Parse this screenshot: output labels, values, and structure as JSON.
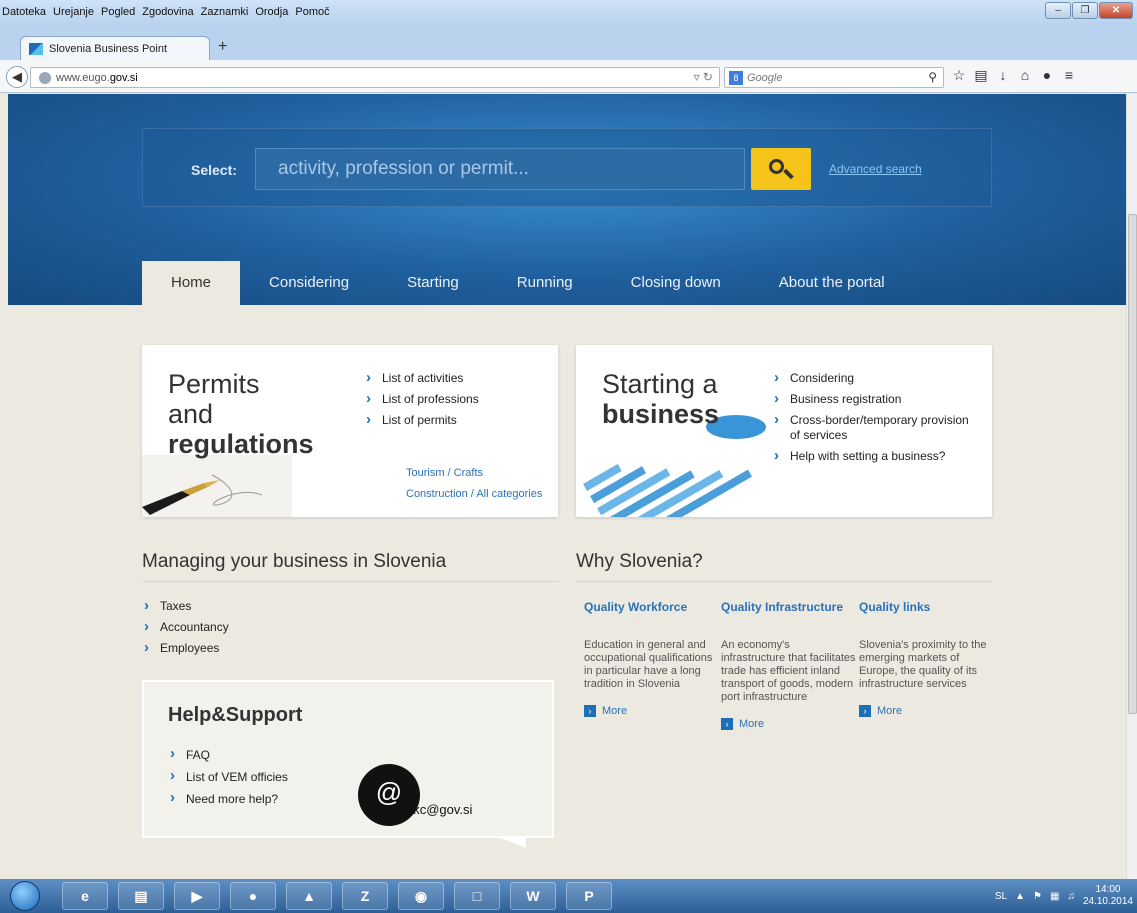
{
  "browser": {
    "menu": [
      "Datoteka",
      "Urejanje",
      "Pogled",
      "Zgodovina",
      "Zaznamki",
      "Orodja",
      "Pomoč"
    ],
    "tab_title": "Slovenia Business Point",
    "url_prefix": "www.eugo.",
    "url_domain": "gov.si",
    "search_placeholder": "Google"
  },
  "hero": {
    "select_label": "Select:",
    "search_placeholder": "activity, profession or permit...",
    "advanced_search": "Advanced search"
  },
  "nav": {
    "items": [
      "Home",
      "Considering",
      "Starting",
      "Running",
      "Closing down",
      "About the portal"
    ],
    "active": "Home"
  },
  "permits": {
    "title_line1": "Permits",
    "title_line2": "and",
    "title_line3": "regulations",
    "links": [
      "List of activities",
      "List of professions",
      "List of permits"
    ],
    "sublinks": [
      "Tourism / Crafts",
      "Construction / All categories"
    ]
  },
  "starting": {
    "title_line1": "Starting a",
    "title_line2": "business",
    "links": [
      "Considering",
      "Business registration",
      "Cross-border/temporary provision of services",
      "Help with setting a business?"
    ]
  },
  "managing": {
    "title": "Managing your business in Slovenia",
    "links": [
      "Taxes",
      "Accountancy",
      "Employees"
    ]
  },
  "why": {
    "title": "Why Slovenia?",
    "columns": [
      {
        "title": "Quality Workforce",
        "text": "Education in general and occupational qualifications in particular have a long tradition in Slovenia",
        "more": "More"
      },
      {
        "title": "Quality Infrastructure",
        "text": "An economy's infrastructure that facilitates trade has efficient inland transport of goods, modern port infrastructure",
        "more": "More"
      },
      {
        "title": "Quality links",
        "text": "Slovenia's proximity to the emerging markets of Europe, the quality of its infrastructure services",
        "more": "More"
      }
    ]
  },
  "help": {
    "title": "Help&Support",
    "links": [
      "FAQ",
      "List of VEM officies",
      "Need more help?"
    ],
    "at": "@",
    "email": "ekc@gov.si"
  },
  "taskbar": {
    "lang": "SL",
    "time": "14:00",
    "date": "24.10.2014"
  }
}
